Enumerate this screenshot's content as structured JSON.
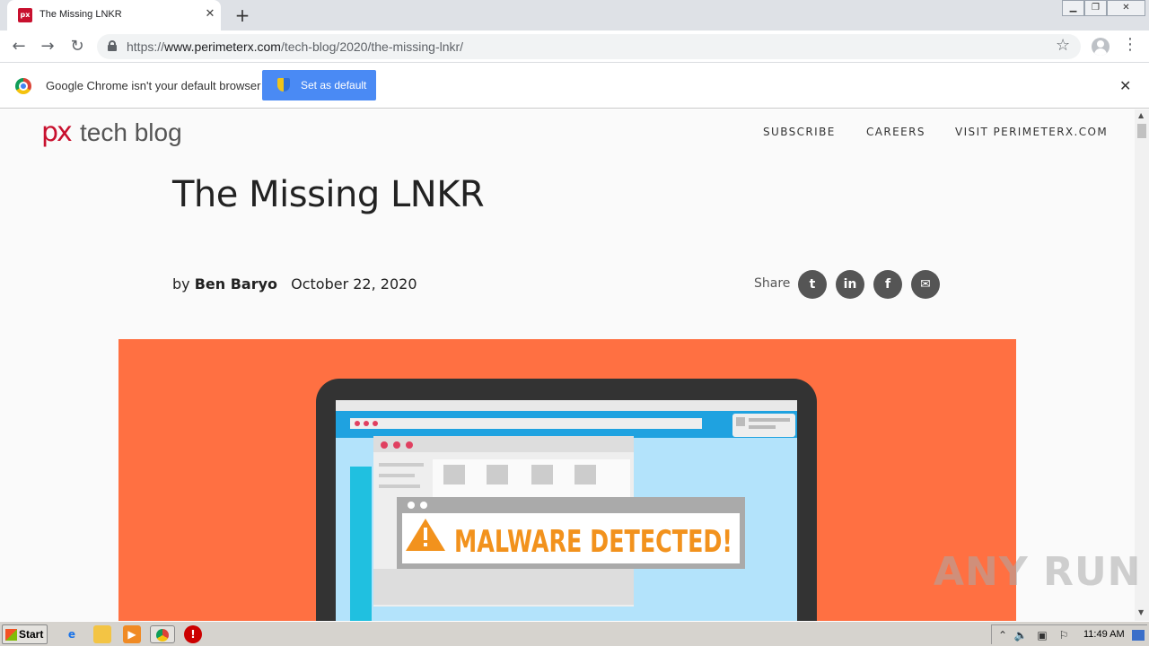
{
  "browser": {
    "tab": {
      "title": "The Missing LNKR",
      "favicon": "px-favicon"
    },
    "new_tab": "+",
    "url": {
      "scheme": "https://",
      "host": "www.perimeterx.com",
      "path": "/tech-blog/2020/the-missing-lnkr/"
    },
    "infobar": {
      "message": "Google Chrome isn't your default browser",
      "button": "Set as default"
    }
  },
  "site": {
    "logo_mark": "px",
    "logo_text": "tech blog",
    "nav": [
      "SUBSCRIBE",
      "CAREERS",
      "VISIT PERIMETERX.COM"
    ]
  },
  "post": {
    "title": "The Missing LNKR",
    "by": "by",
    "author": "Ben Baryo",
    "date": "October 22, 2020",
    "share_label": "Share",
    "share_buttons": [
      {
        "icon": "twitter-icon",
        "glyph": "t"
      },
      {
        "icon": "linkedin-icon",
        "glyph": "in"
      },
      {
        "icon": "facebook-icon",
        "glyph": "f"
      },
      {
        "icon": "email-icon",
        "glyph": "✉"
      }
    ]
  },
  "hero": {
    "alert_text": "MALWARE DETECTED!",
    "background": "#ff7042"
  },
  "watermark": "ANY RUN",
  "taskbar": {
    "start": "Start",
    "clock": "11:49 AM"
  },
  "colors": {
    "brand": "#c8102e",
    "button_blue": "#4a8af4",
    "share_gray": "#555555"
  }
}
